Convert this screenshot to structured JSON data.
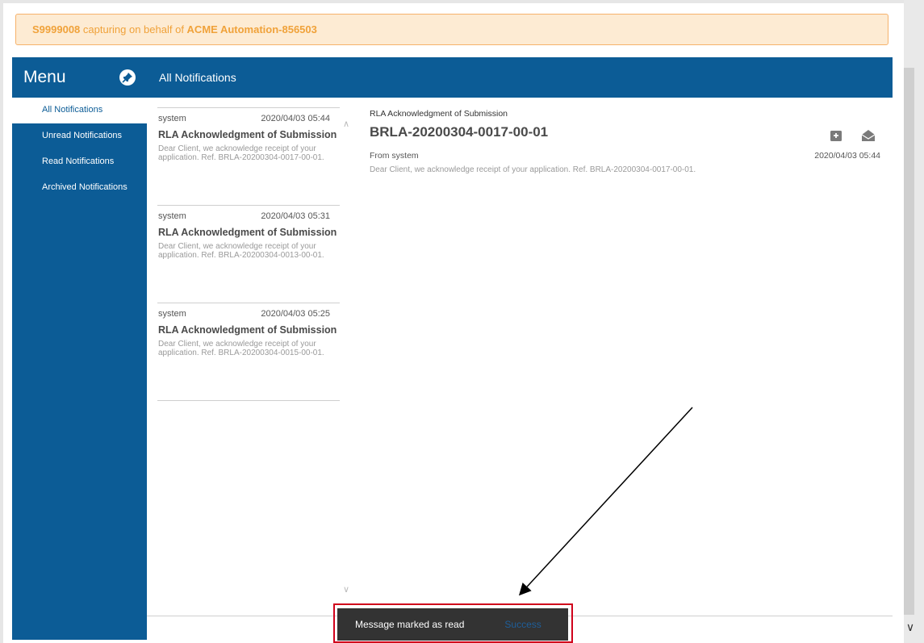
{
  "banner": {
    "user_id": "S9999008",
    "middle_text": " capturing on behalf of ",
    "org": "ACME Automation-856503"
  },
  "sidebar": {
    "title": "Menu",
    "pin_icon": "pin-icon",
    "items": [
      {
        "label": "All Notifications",
        "active": true
      },
      {
        "label": "Unread Notifications",
        "active": false
      },
      {
        "label": "Read Notifications",
        "active": false
      },
      {
        "label": "Archived Notifications",
        "active": false
      }
    ]
  },
  "topbar": {
    "title": "All Notifications"
  },
  "messages": [
    {
      "sender": "system",
      "date": "2020/04/03 05:44",
      "title": "RLA Acknowledgment of Submission",
      "body": "Dear Client, we acknowledge receipt of your application. Ref. BRLA-20200304-0017-00-01."
    },
    {
      "sender": "system",
      "date": "2020/04/03 05:31",
      "title": "RLA Acknowledgment of Submission",
      "body": "Dear Client, we acknowledge receipt of your application. Ref. BRLA-20200304-0013-00-01."
    },
    {
      "sender": "system",
      "date": "2020/04/03 05:25",
      "title": "RLA Acknowledgment of Submission",
      "body": "Dear Client, we acknowledge receipt of your application. Ref. BRLA-20200304-0015-00-01."
    }
  ],
  "detail": {
    "subtitle": "RLA Acknowledgment of Submission",
    "title": "BRLA-20200304-0017-00-01",
    "from": "From system",
    "date": "2020/04/03 05:44",
    "body": "Dear Client, we acknowledge receipt of your application. Ref. BRLA-20200304-0017-00-01.",
    "archive_icon": "archive-icon",
    "mark_read_icon": "envelope-open-icon"
  },
  "toast": {
    "message": "Message marked as read",
    "action": "Success"
  },
  "colors": {
    "primary": "#0c5c96",
    "banner_bg": "#fdebd3",
    "banner_text": "#f0a23a",
    "highlight": "#d0021b",
    "toast_bg": "#333333"
  }
}
